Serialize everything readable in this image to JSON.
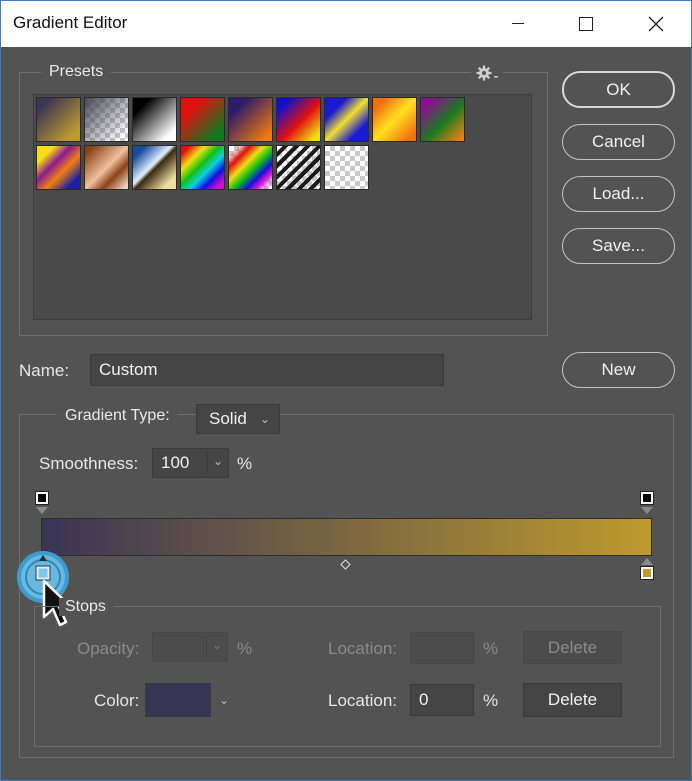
{
  "window": {
    "title": "Gradient Editor",
    "minimize_glyph": "—",
    "close_glyph": "✕"
  },
  "presets": {
    "legend": "Presets",
    "gear_icon": "gear-icon",
    "swatches": [
      {
        "name": "preset-foreground-to-background",
        "css": "linear-gradient(135deg, #3a3554 15%, #bf9a2e 85%)"
      },
      {
        "name": "preset-foreground-to-transparent",
        "css": "linear-gradient(135deg, #4a4a5a 0%, rgba(255,255,255,0) 90%)",
        "checker": true
      },
      {
        "name": "preset-black-white",
        "css": "linear-gradient(135deg, #000 20%, #fff 85%)"
      },
      {
        "name": "preset-red-green",
        "css": "linear-gradient(135deg, #e01010 25%, #0f7a20 85%)"
      },
      {
        "name": "preset-violet-orange",
        "css": "linear-gradient(135deg, #2c1a6a 20%, #f07a10 90%)"
      },
      {
        "name": "preset-blue-red-yellow",
        "css": "linear-gradient(135deg, #1010d0 15%, #e01010 55%, #f0e010 90%)"
      },
      {
        "name": "preset-blue-yellow-blue",
        "css": "linear-gradient(135deg, #1a1ad0 25%, #f0e030 50%, #1a1ad0 78%)"
      },
      {
        "name": "preset-orange-yellow-orange",
        "css": "linear-gradient(135deg, #f07010 15%, #ffe020 50%, #f07010 90%)"
      },
      {
        "name": "preset-violet-green-orange",
        "css": "linear-gradient(135deg, #8a1090 15%, #1a7a20 55%, #f08010 95%)"
      },
      {
        "name": "preset-yellow-violet-orange-blue",
        "css": "linear-gradient(135deg, #f8e010 20%, #8a1a90 40%, #f08010 60%, #1a20a0 85%)"
      },
      {
        "name": "preset-copper",
        "css": "linear-gradient(135deg, #8a4218 10%, #f0c0a0 50%, #8a4218 70%, #f3d2bd 95%)"
      },
      {
        "name": "preset-chrome",
        "css": "linear-gradient(135deg, #1a4a9a 15%, #e0f0ff 45%, #3a2810 52%, #f0e0a0 85%)"
      },
      {
        "name": "preset-spectrum",
        "css": "linear-gradient(135deg, #e01010 10%, #f0e010 28%, #10c010 45%, #10d0e0 60%, #1010e0 75%, #d010d0 90%)"
      },
      {
        "name": "preset-transparent-rainbow",
        "css": "linear-gradient(135deg, rgba(255,255,255,0) 10%, #e01010 25%, #f0e010 40%, #10c010 55%, #1010e0 70%, #d010d0 80%, rgba(255,255,255,0) 95%)",
        "checker": true
      },
      {
        "name": "preset-transparent-stripes",
        "css": "repeating-linear-gradient(135deg, rgba(0,0,0,0) 0px, rgba(0,0,0,0) 4px, #1a1a1a 4px, #1a1a1a 8px)",
        "checker": true
      },
      {
        "name": "preset-transparent",
        "css": "none",
        "checker": true
      }
    ]
  },
  "buttons": {
    "ok": "OK",
    "cancel": "Cancel",
    "load": "Load...",
    "save": "Save...",
    "new": "New"
  },
  "name_field": {
    "label": "Name:",
    "value": "Custom"
  },
  "gradient": {
    "type_label": "Gradient Type:",
    "type_value": "Solid",
    "smoothness_label": "Smoothness:",
    "smoothness_value": "100",
    "percent": "%",
    "start_color": "#383554",
    "end_color": "#bf9a2e",
    "opacity_stop_color": "#000000"
  },
  "stops": {
    "legend": "Stops",
    "opacity_label": "Opacity:",
    "opacity_value": "",
    "opacity_percent": "%",
    "opacity_location_label": "Location:",
    "opacity_location_value": "",
    "opacity_location_percent": "%",
    "opacity_delete": "Delete",
    "color_label": "Color:",
    "color_value": "#383554",
    "color_location_label": "Location:",
    "color_location_value": "0",
    "color_location_percent": "%",
    "color_delete": "Delete"
  }
}
